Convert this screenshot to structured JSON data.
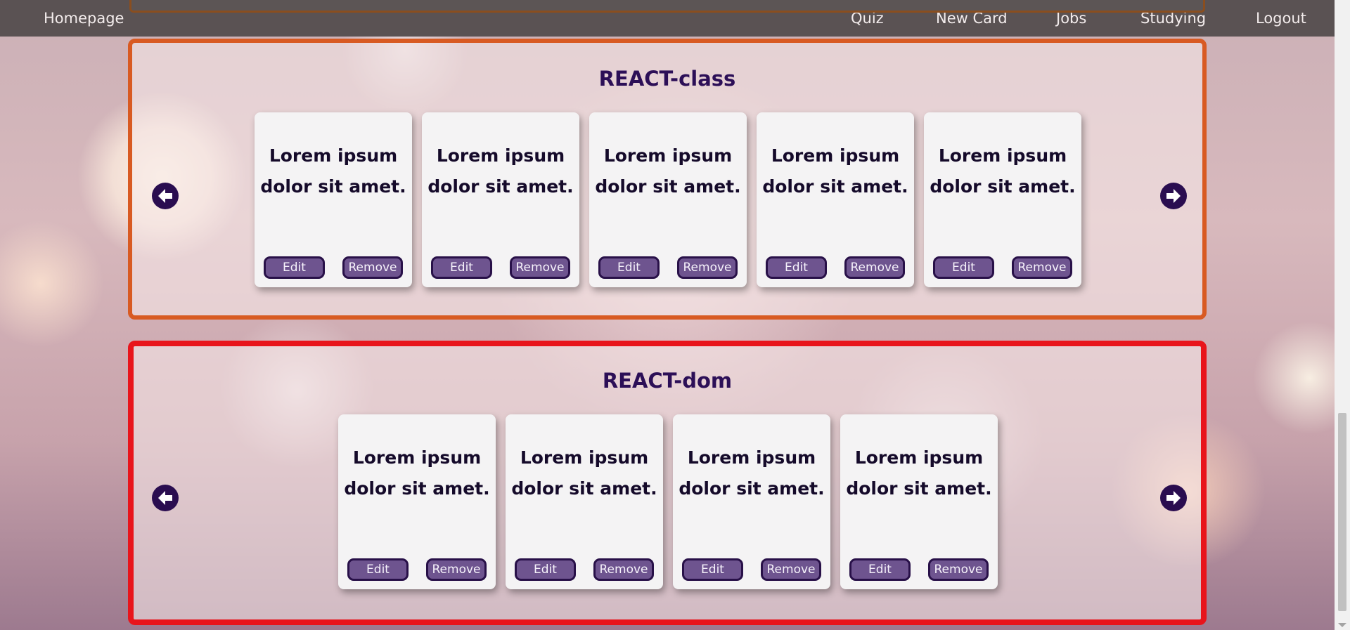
{
  "nav": {
    "homepage": "Homepage",
    "links": [
      "Quiz",
      "New Card",
      "Jobs",
      "Studying",
      "Logout"
    ]
  },
  "decks": [
    {
      "title": "REACT-class",
      "border_color": "#d85a22",
      "cards": [
        {
          "text": "Lorem ipsum dolor sit amet.",
          "edit": "Edit",
          "remove": "Remove"
        },
        {
          "text": "Lorem ipsum dolor sit amet.",
          "edit": "Edit",
          "remove": "Remove"
        },
        {
          "text": "Lorem ipsum dolor sit amet.",
          "edit": "Edit",
          "remove": "Remove"
        },
        {
          "text": "Lorem ipsum dolor sit amet.",
          "edit": "Edit",
          "remove": "Remove"
        },
        {
          "text": "Lorem ipsum dolor sit amet.",
          "edit": "Edit",
          "remove": "Remove"
        }
      ],
      "prev_icon": "arrow-left-circle-icon",
      "next_icon": "arrow-right-circle-icon"
    },
    {
      "title": "REACT-dom",
      "border_color": "#e8141b",
      "cards": [
        {
          "text": "Lorem ipsum dolor sit amet.",
          "edit": "Edit",
          "remove": "Remove"
        },
        {
          "text": "Lorem ipsum dolor sit amet.",
          "edit": "Edit",
          "remove": "Remove"
        },
        {
          "text": "Lorem ipsum dolor sit amet.",
          "edit": "Edit",
          "remove": "Remove"
        },
        {
          "text": "Lorem ipsum dolor sit amet.",
          "edit": "Edit",
          "remove": "Remove"
        }
      ],
      "prev_icon": "arrow-left-circle-icon",
      "next_icon": "arrow-right-circle-icon"
    }
  ],
  "colors": {
    "navbar": "#5a5253",
    "title": "#2c0f57",
    "button_fill": "#6e548f",
    "button_border": "#281048"
  }
}
